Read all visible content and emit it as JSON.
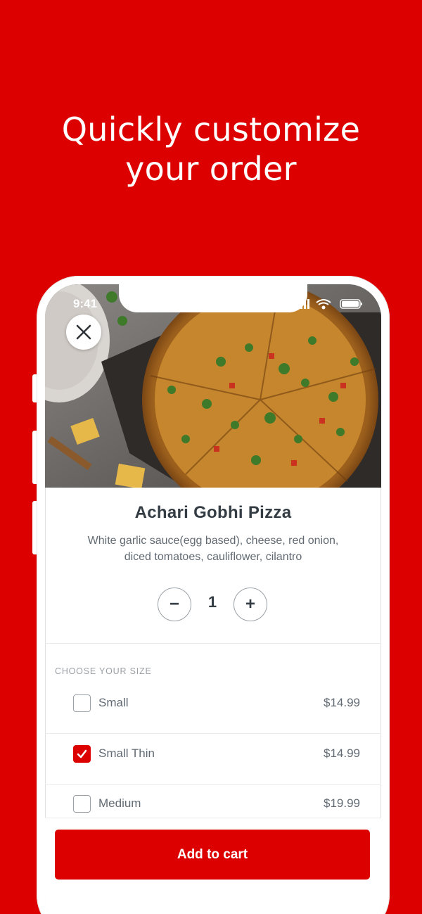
{
  "colors": {
    "brand_red": "#dc0000",
    "text_dark": "#343c44",
    "text_muted": "#616a72"
  },
  "headline": {
    "line1": "Quickly customize",
    "line2": "your order"
  },
  "status_bar": {
    "time": "9:41",
    "icons": [
      "signal-icon",
      "wifi-icon",
      "battery-icon"
    ]
  },
  "hero": {
    "close_icon": "close-icon"
  },
  "product": {
    "title": "Achari Gobhi Pizza",
    "description_line1": "White garlic sauce(egg based), cheese, red onion,",
    "description_line2": "diced tomatoes, cauliflower, cilantro"
  },
  "quantity": {
    "minus": "−",
    "value": "1",
    "plus": "+"
  },
  "size_section": {
    "label": "CHOOSE YOUR SIZE",
    "options": [
      {
        "name": "Small",
        "price": "$14.99",
        "checked": false
      },
      {
        "name": "Small Thin",
        "price": "$14.99",
        "checked": true
      },
      {
        "name": "Medium",
        "price": "$19.99",
        "checked": false
      }
    ]
  },
  "cart": {
    "button_label": "Add to cart"
  }
}
